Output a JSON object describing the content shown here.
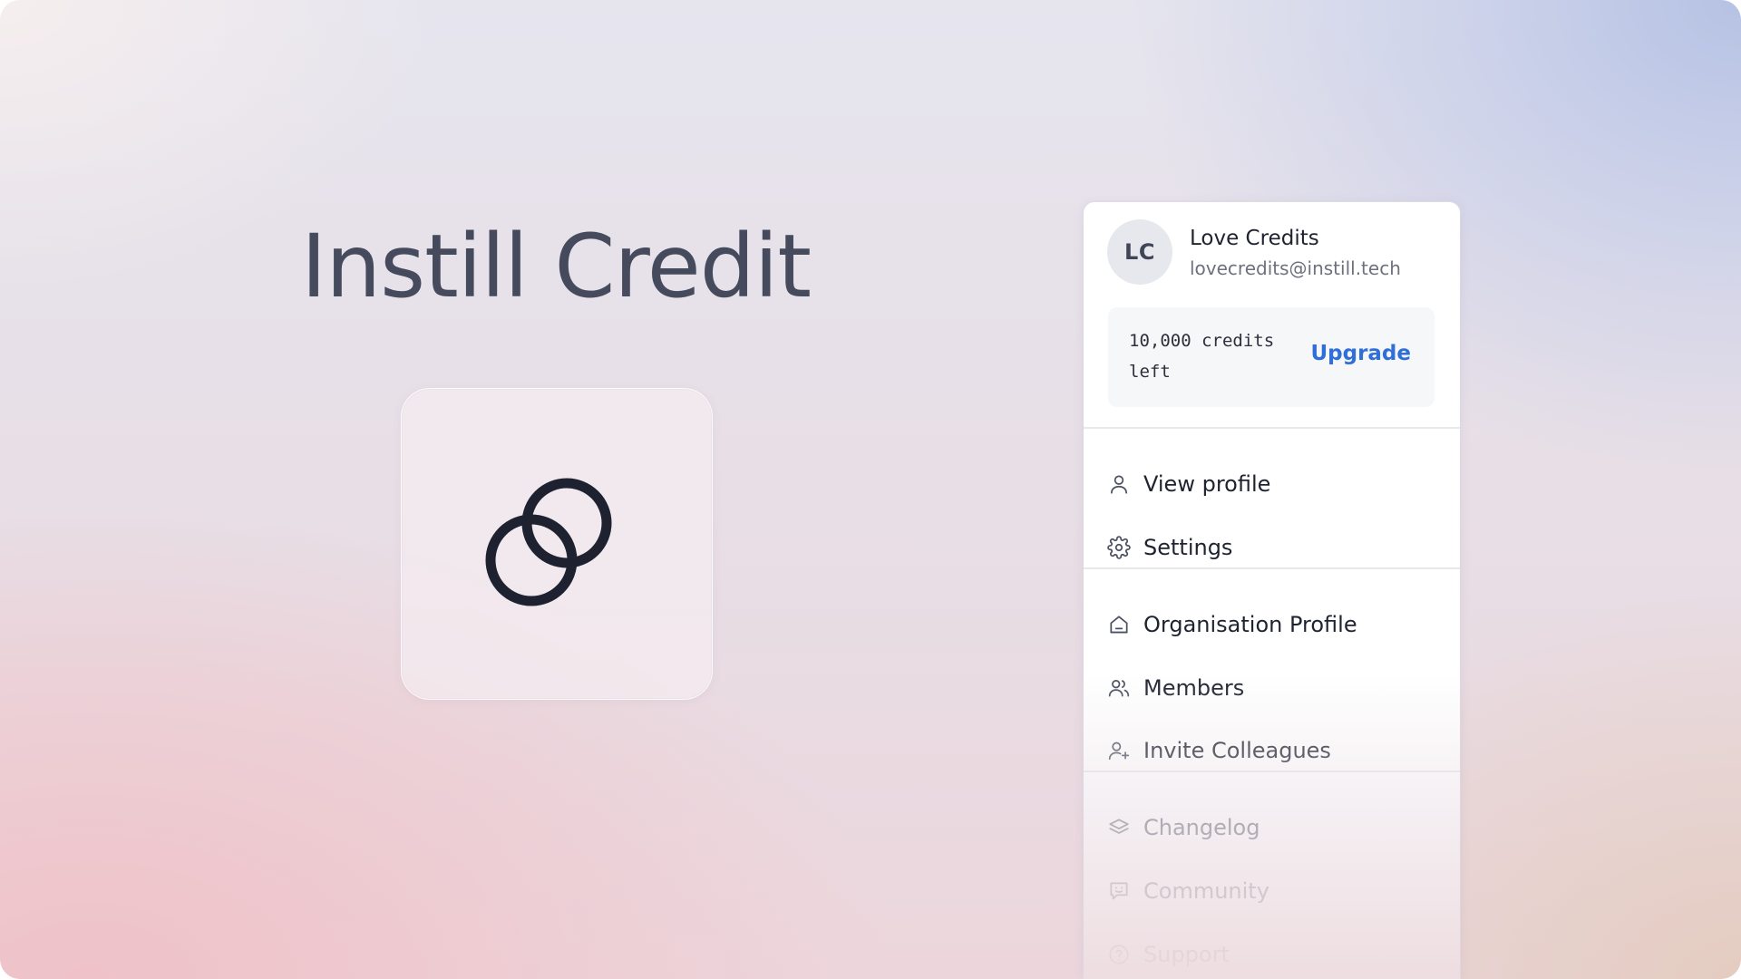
{
  "hero": {
    "title": "Instill Credit",
    "icon": "overlapping-circles-icon"
  },
  "account": {
    "avatar_initials": "LC",
    "name": "Love Credits",
    "email": "lovecredits@instill.tech"
  },
  "credits": {
    "balance_text": "10,000 credits left",
    "upgrade_label": "Upgrade",
    "accent_color": "#316fd8"
  },
  "menu": {
    "personal": [
      {
        "label": "View profile",
        "icon": "user-icon"
      },
      {
        "label": "Settings",
        "icon": "gear-icon"
      }
    ],
    "organisation": [
      {
        "label": "Organisation Profile",
        "icon": "building-icon"
      },
      {
        "label": "Members",
        "icon": "users-icon"
      },
      {
        "label": "Invite Colleagues",
        "icon": "user-plus-icon"
      }
    ],
    "resources": [
      {
        "label": "Changelog",
        "icon": "layers-icon"
      },
      {
        "label": "Community",
        "icon": "chat-smile-icon"
      },
      {
        "label": "Support",
        "icon": "help-circle-icon"
      }
    ]
  }
}
